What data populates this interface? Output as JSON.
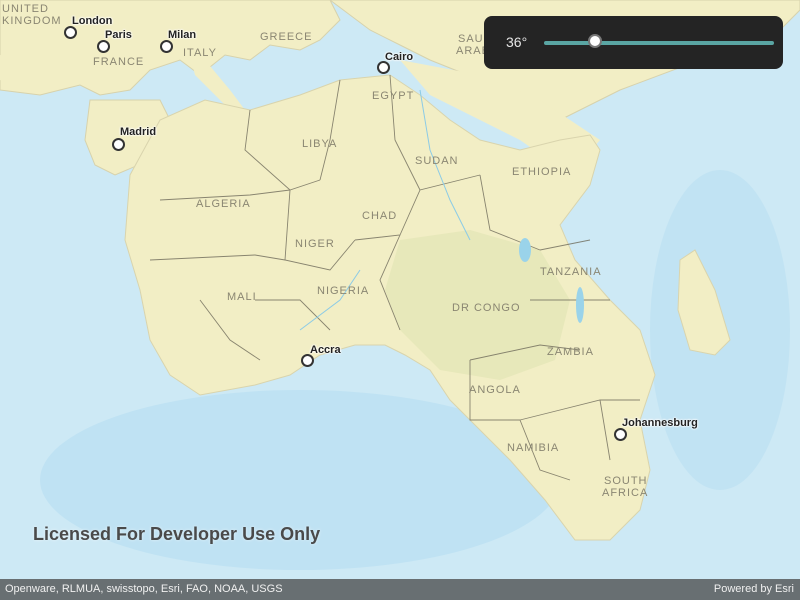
{
  "slider": {
    "value_label": "36°",
    "value_fraction": 0.22
  },
  "watermark": "Licensed For Developer Use Only",
  "attribution": {
    "sources": "Openware, RLMUA, swisstopo, Esri, FAO, NOAA, USGS",
    "powered_by": "Powered by Esri"
  },
  "map": {
    "country_labels": [
      "UNITED",
      "KINGDOM",
      "FRANCE",
      "ITALY",
      "GREECE",
      "SAUDI",
      "ARABIA",
      "EGYPT",
      "LIBYA",
      "SUDAN",
      "ETHIOPIA",
      "ALGERIA",
      "CHAD",
      "NIGER",
      "MALI",
      "NIGERIA",
      "TANZANIA",
      "DR CONGO",
      "ZAMBIA",
      "ANGOLA",
      "NAMIBIA",
      "SOUTH",
      "AFRICA"
    ],
    "cities": [
      "London",
      "Paris",
      "Milan",
      "Cairo",
      "Madrid",
      "Accra",
      "Johannesburg"
    ]
  },
  "colors": {
    "ocean": "#cde9f5",
    "land": "#f2eec5",
    "border": "#6e6a5a",
    "slider_bg": "#242424",
    "slider_track": "#5aa5a3"
  }
}
